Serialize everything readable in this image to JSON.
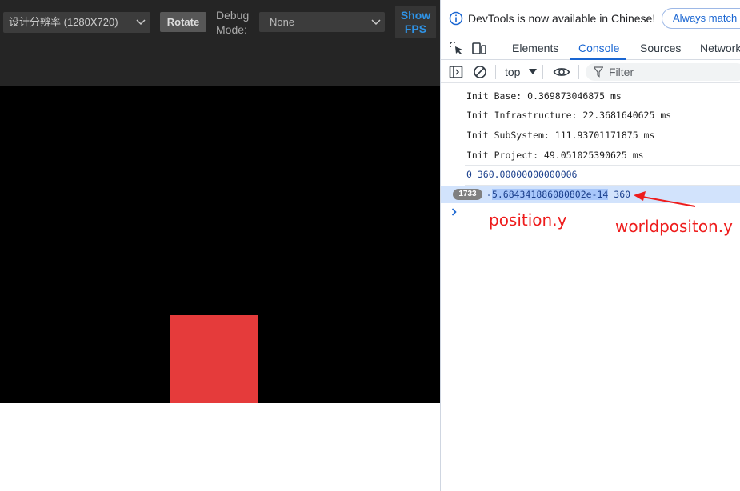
{
  "preview": {
    "resolution": "设计分辨率 (1280X720)",
    "rotate": "Rotate",
    "debug_label": "Debug Mode:",
    "debug_mode": "None",
    "show_fps": "Show FPS"
  },
  "devtools": {
    "info": {
      "message": "DevTools is now available in Chinese!",
      "always_match": "Always match"
    },
    "tabs": [
      "Elements",
      "Console",
      "Sources",
      "Network"
    ],
    "active_tab": "Console",
    "toolbar": {
      "context": "top",
      "filter_placeholder": "Filter"
    },
    "logs": [
      "Init Base: 0.369873046875 ms",
      "Init Infrastructure: 22.3681640625 ms",
      "Init SubSystem: 111.93701171875 ms",
      "Init Project: 49.051025390625 ms",
      "0 360.00000000000006"
    ],
    "selected_log": {
      "count": "1733",
      "prefix": "-",
      "highlighted": "5.684341886080802e-14",
      "rest": " 360"
    }
  },
  "annotations": {
    "position_y": "position.y",
    "world_position_y": "worldpositon.y"
  },
  "colors": {
    "accent": "#1a66d2",
    "annotation": "#ee1c1c",
    "rect": "#e53b3b"
  }
}
